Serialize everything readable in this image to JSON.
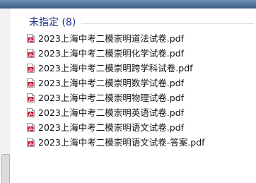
{
  "window": {
    "title": "",
    "accent_color": "#1e3287"
  },
  "group": {
    "title": "未指定 (8)"
  },
  "files": [
    {
      "name": "2023上海中考二模崇明道法试卷.pdf",
      "icon": "pdf-file-icon"
    },
    {
      "name": "2023上海中考二模崇明化学试卷.pdf",
      "icon": "pdf-file-icon"
    },
    {
      "name": "2023上海中考二模崇明跨学科试卷.pdf",
      "icon": "pdf-file-icon"
    },
    {
      "name": "2023上海中考二模崇明数学试卷.pdf",
      "icon": "pdf-file-icon"
    },
    {
      "name": "2023上海中考二模崇明物理试卷.pdf",
      "icon": "pdf-file-icon"
    },
    {
      "name": "2023上海中考二模崇明英语试卷.pdf",
      "icon": "pdf-file-icon"
    },
    {
      "name": "2023上海中考二模崇明语文试卷.pdf",
      "icon": "pdf-file-icon"
    },
    {
      "name": "2023上海中考二模崇明语文试卷-答案.pdf",
      "icon": "pdf-file-icon"
    }
  ]
}
